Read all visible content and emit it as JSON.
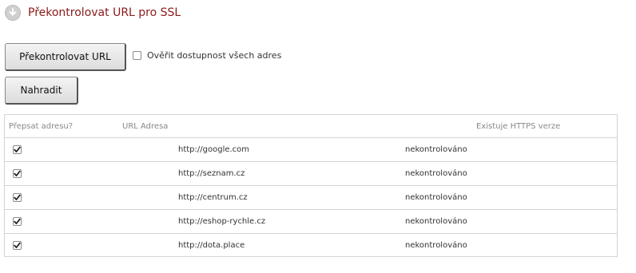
{
  "header": {
    "icon": "arrow-down-circle-icon",
    "title": "Překontrolovat URL pro SSL"
  },
  "toolbar": {
    "check_label": "Překontrolovat URL",
    "verify_all_label": "Ověřit dostupnost všech adres",
    "verify_all_checked": false,
    "replace_label": "Nahradit"
  },
  "table": {
    "columns": [
      "Přepsat adresu?",
      "URL Adresa",
      "Existuje HTTPS verze"
    ],
    "rows": [
      {
        "checked": true,
        "url": "http://google.com",
        "status": "nekontrolováno"
      },
      {
        "checked": true,
        "url": "http://seznam.cz",
        "status": "nekontrolováno"
      },
      {
        "checked": true,
        "url": "http://centrum.cz",
        "status": "nekontrolováno"
      },
      {
        "checked": true,
        "url": "http://eshop-rychle.cz",
        "status": "nekontrolováno"
      },
      {
        "checked": true,
        "url": "http://dota.place",
        "status": "nekontrolováno"
      }
    ]
  },
  "colors": {
    "title": "#8b1a1a",
    "border": "#d4d4d4",
    "header_text": "#888888"
  }
}
